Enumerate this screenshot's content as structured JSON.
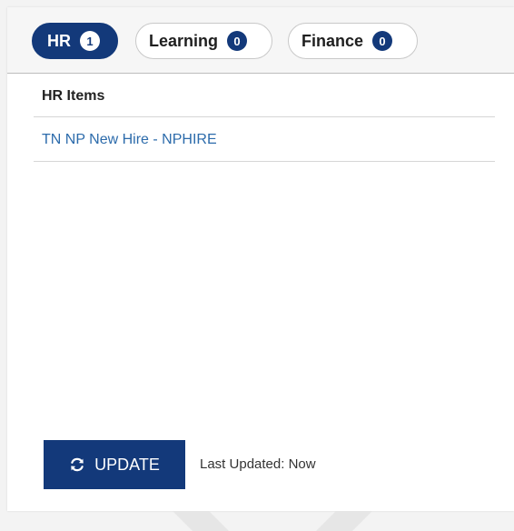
{
  "tabs": [
    {
      "label": "HR",
      "count": "1"
    },
    {
      "label": "Learning",
      "count": "0"
    },
    {
      "label": "Finance",
      "count": "0"
    }
  ],
  "section": {
    "title": "HR Items",
    "items": [
      {
        "label": "TN NP New Hire - NPHIRE"
      }
    ]
  },
  "footer": {
    "update_label": "UPDATE",
    "last_updated": "Last Updated: Now"
  },
  "colors": {
    "primary": "#13397a",
    "link": "#2c6bab"
  },
  "icons": {
    "update": "refresh-icon"
  }
}
